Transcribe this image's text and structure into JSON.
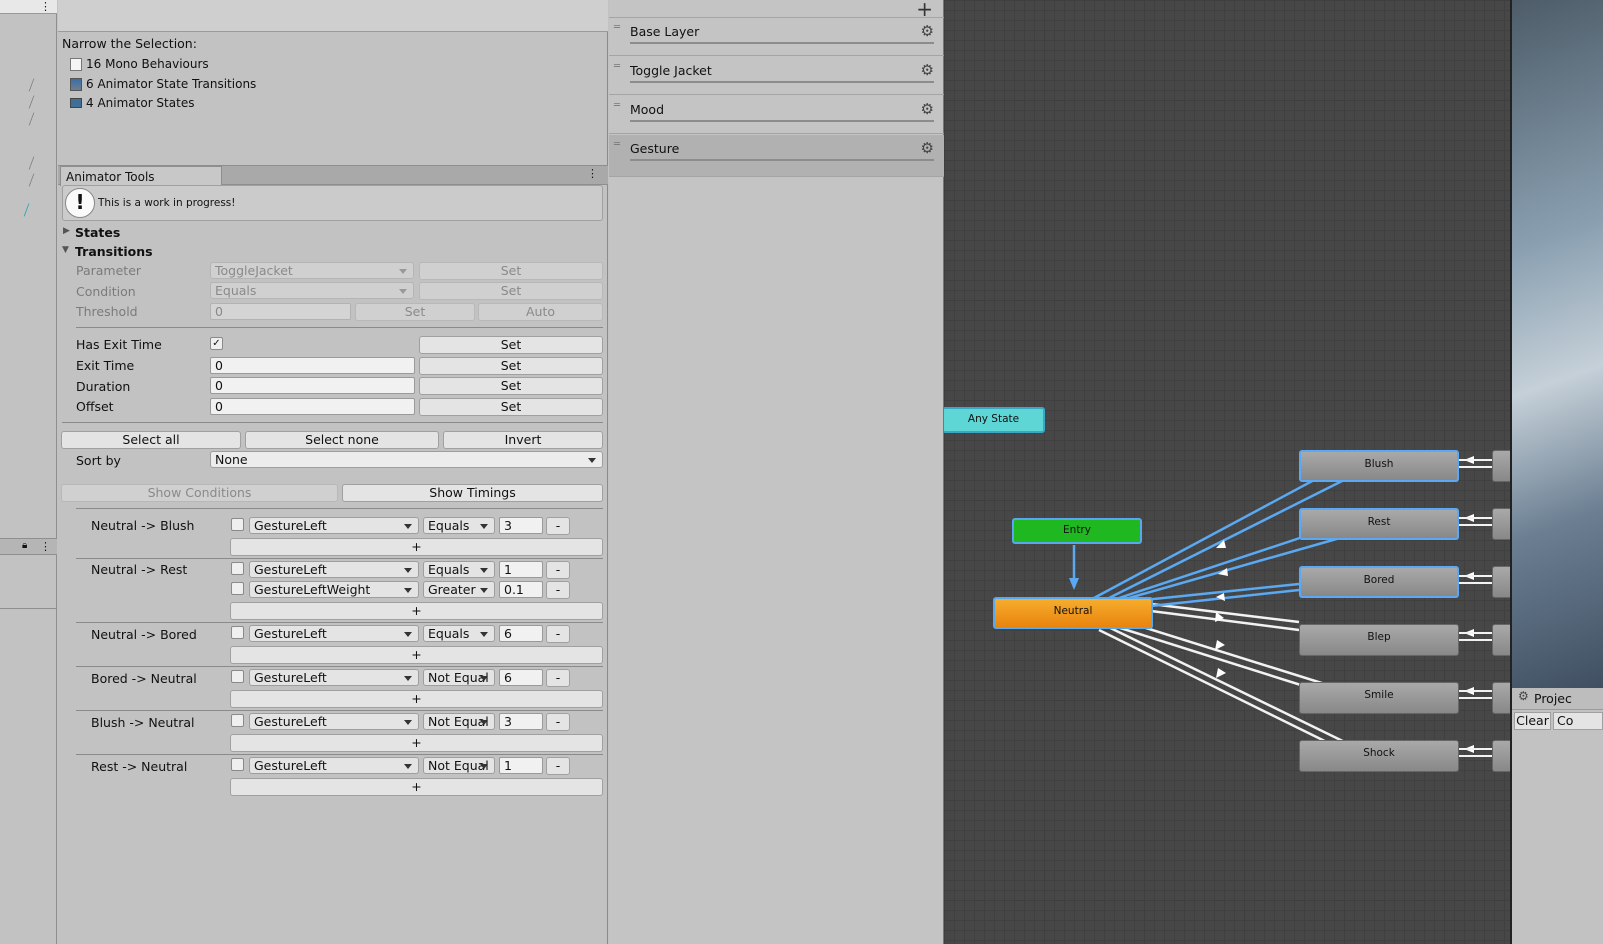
{
  "narrow": {
    "heading": "Narrow the Selection:",
    "items": [
      {
        "label": "16 Mono Behaviours",
        "icon": "script-icon"
      },
      {
        "label": "6 Animator State Transitions",
        "icon": "transition-icon"
      },
      {
        "label": "4 Animator States",
        "icon": "state-icon"
      }
    ]
  },
  "tool": {
    "tab_label": "Animator Tools",
    "info_message": "This is a work in progress!",
    "states_label": "States",
    "transitions_label": "Transitions",
    "parameter_label": "Parameter",
    "parameter_value": "ToggleJacket",
    "condition_label": "Condition",
    "condition_value": "Equals",
    "threshold_label": "Threshold",
    "threshold_value": "0",
    "set_label": "Set",
    "auto_label": "Auto",
    "has_exit_time_label": "Has Exit Time",
    "has_exit_time_checked": "✓",
    "exit_time_label": "Exit Time",
    "exit_time_value": "0",
    "duration_label": "Duration",
    "duration_value": "0",
    "offset_label": "Offset",
    "offset_value": "0",
    "select_all": "Select all",
    "select_none": "Select none",
    "invert": "Invert",
    "sort_by_label": "Sort by",
    "sort_by_value": "None",
    "show_conditions": "Show Conditions",
    "show_timings": "Show Timings",
    "plus": "+",
    "minus": "-"
  },
  "transitions": [
    {
      "name": "Neutral -> Blush",
      "conditions": [
        {
          "param": "GestureLeft",
          "op": "Equals",
          "value": "3"
        }
      ]
    },
    {
      "name": "Neutral -> Rest",
      "conditions": [
        {
          "param": "GestureLeft",
          "op": "Equals",
          "value": "1"
        },
        {
          "param": "GestureLeftWeight",
          "op": "Greater",
          "value": "0.1"
        }
      ]
    },
    {
      "name": "Neutral -> Bored",
      "conditions": [
        {
          "param": "GestureLeft",
          "op": "Equals",
          "value": "6"
        }
      ]
    },
    {
      "name": "Bored -> Neutral",
      "conditions": [
        {
          "param": "GestureLeft",
          "op": "Not Equal",
          "value": "6"
        }
      ]
    },
    {
      "name": "Blush -> Neutral",
      "conditions": [
        {
          "param": "GestureLeft",
          "op": "Not Equal",
          "value": "3"
        }
      ]
    },
    {
      "name": "Rest -> Neutral",
      "conditions": [
        {
          "param": "GestureLeft",
          "op": "Not Equal",
          "value": "1"
        }
      ]
    }
  ],
  "layers": {
    "add_button": "+",
    "items": [
      "Base Layer",
      "Toggle Jacket",
      "Mood",
      "Gesture"
    ]
  },
  "graph": {
    "any_state": "Any State",
    "entry": "Entry",
    "neutral": "Neutral",
    "states": [
      "Blush",
      "Rest",
      "Bored",
      "Blep",
      "Smile",
      "Shock"
    ],
    "colors": {
      "any_state": "#5fd6d6",
      "entry": "#20b820",
      "neutral": "#f0961a",
      "selection": "#5aa9f2"
    }
  },
  "project": {
    "tab_label": "Projec",
    "clear_button": "Clear",
    "collapse_button": "Co"
  }
}
